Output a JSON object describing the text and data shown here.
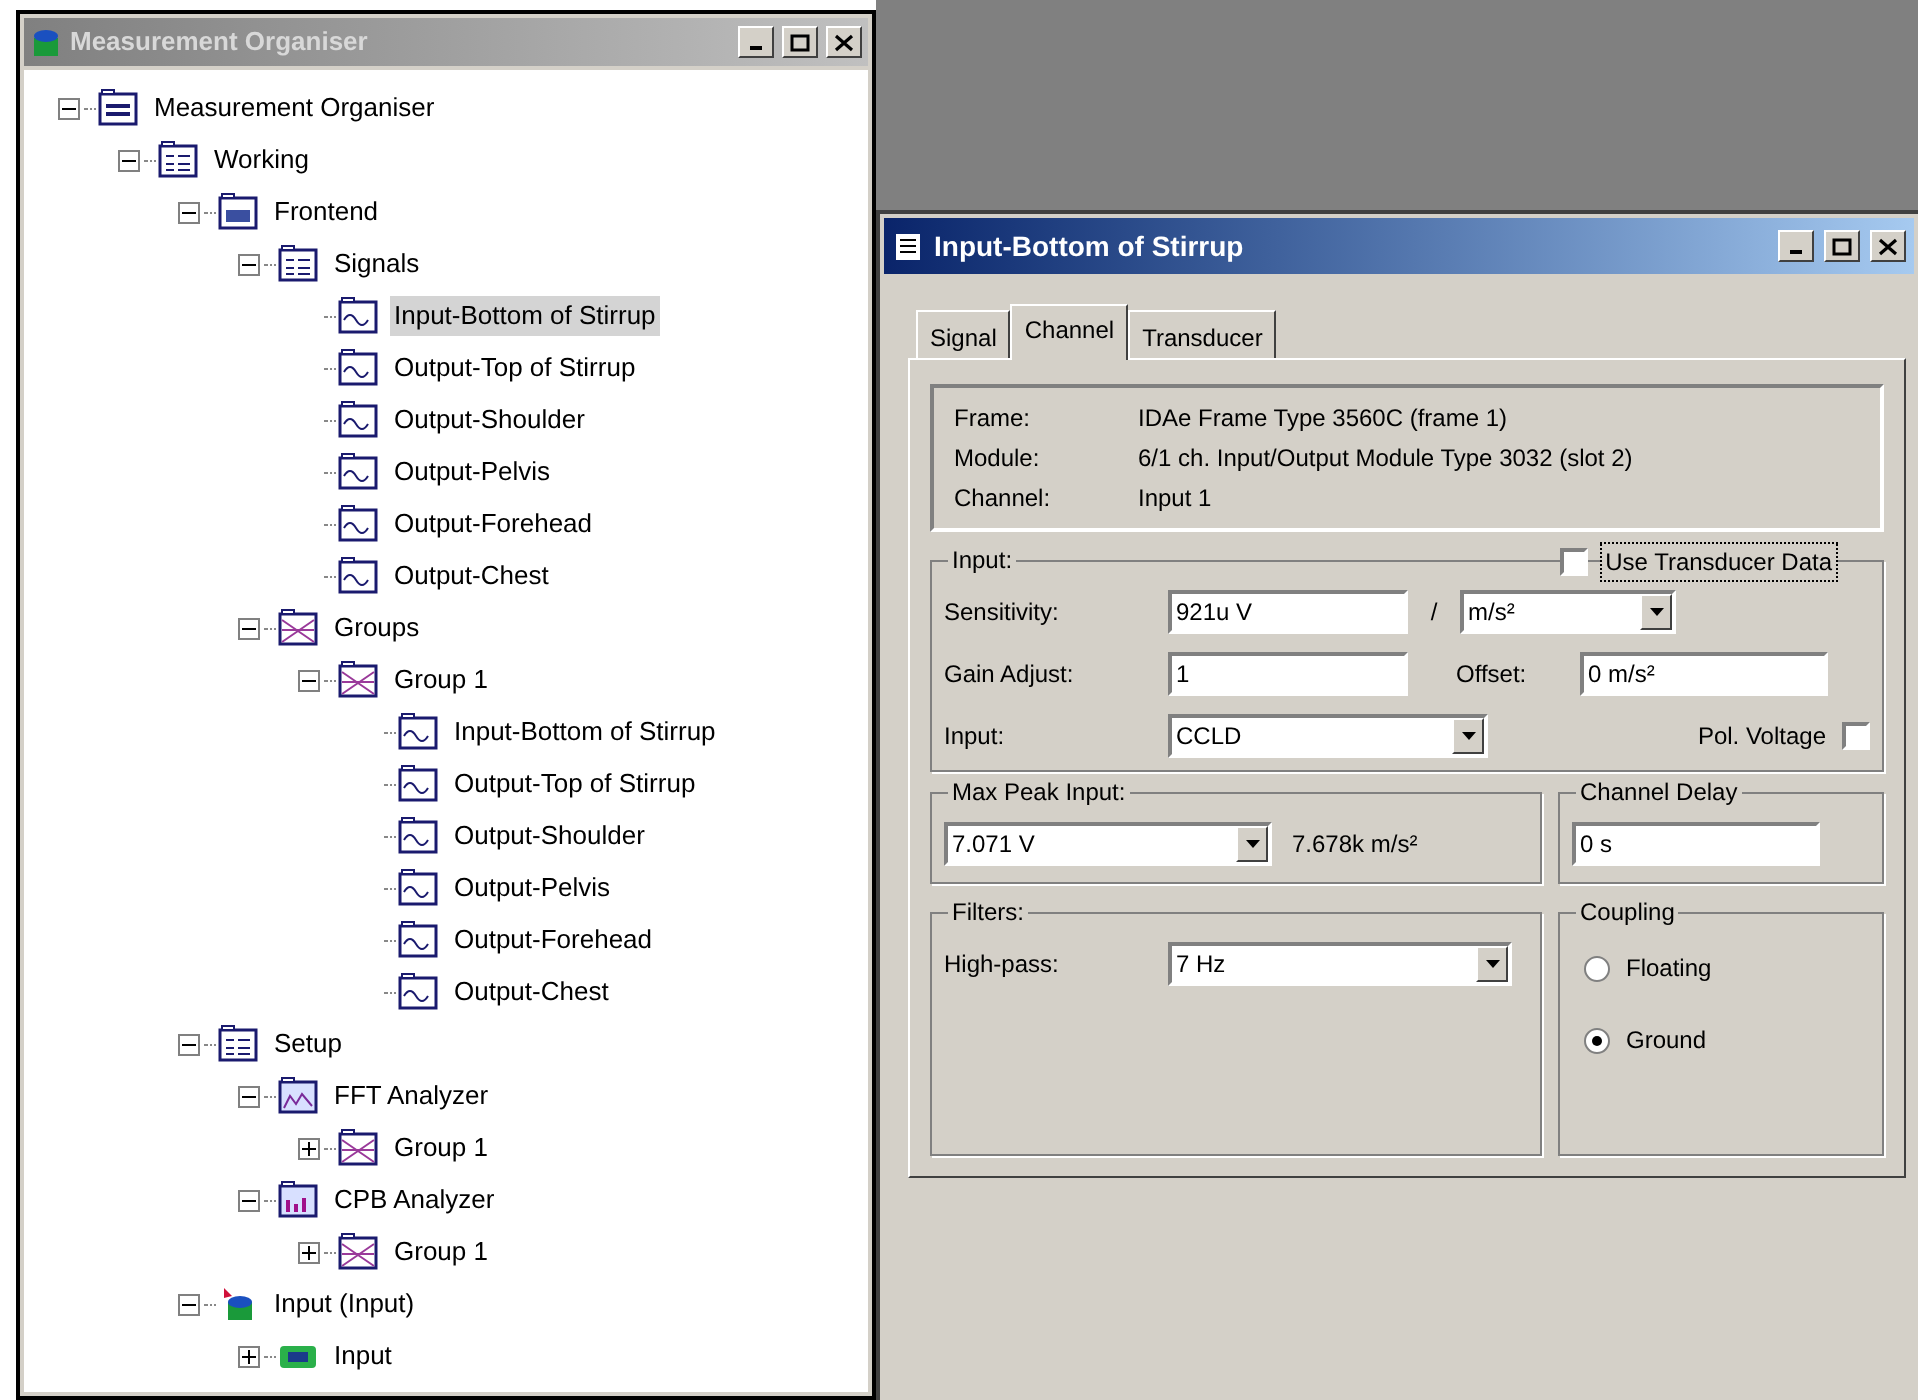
{
  "organiser": {
    "title": "Measurement Organiser",
    "tree": [
      {
        "label": "Measurement Organiser",
        "kind": "organiser",
        "expanded": true,
        "selected": false,
        "children": [
          {
            "label": "Working",
            "kind": "list",
            "expanded": true,
            "selected": false,
            "children": [
              {
                "label": "Frontend",
                "kind": "frontend",
                "expanded": true,
                "selected": false,
                "children": [
                  {
                    "label": "Signals",
                    "kind": "list",
                    "expanded": true,
                    "selected": false,
                    "children": [
                      {
                        "label": "Input-Bottom of Stirrup",
                        "kind": "signal",
                        "selected": true
                      },
                      {
                        "label": "Output-Top of Stirrup",
                        "kind": "signal",
                        "selected": false
                      },
                      {
                        "label": "Output-Shoulder",
                        "kind": "signal",
                        "selected": false
                      },
                      {
                        "label": "Output-Pelvis",
                        "kind": "signal",
                        "selected": false
                      },
                      {
                        "label": "Output-Forehead",
                        "kind": "signal",
                        "selected": false
                      },
                      {
                        "label": "Output-Chest",
                        "kind": "signal",
                        "selected": false
                      }
                    ]
                  },
                  {
                    "label": "Groups",
                    "kind": "group",
                    "expanded": true,
                    "selected": false,
                    "children": [
                      {
                        "label": "Group 1",
                        "kind": "group",
                        "expanded": true,
                        "selected": false,
                        "children": [
                          {
                            "label": "Input-Bottom of Stirrup",
                            "kind": "signal",
                            "selected": false
                          },
                          {
                            "label": "Output-Top of Stirrup",
                            "kind": "signal",
                            "selected": false
                          },
                          {
                            "label": "Output-Shoulder",
                            "kind": "signal",
                            "selected": false
                          },
                          {
                            "label": "Output-Pelvis",
                            "kind": "signal",
                            "selected": false
                          },
                          {
                            "label": "Output-Forehead",
                            "kind": "signal",
                            "selected": false
                          },
                          {
                            "label": "Output-Chest",
                            "kind": "signal",
                            "selected": false
                          }
                        ]
                      }
                    ]
                  }
                ]
              },
              {
                "label": "Setup",
                "kind": "list",
                "expanded": true,
                "selected": false,
                "children": [
                  {
                    "label": "FFT Analyzer",
                    "kind": "fft",
                    "expanded": true,
                    "selected": false,
                    "children": [
                      {
                        "label": "Group 1",
                        "kind": "group",
                        "expanded": false,
                        "selected": false
                      }
                    ]
                  },
                  {
                    "label": "CPB Analyzer",
                    "kind": "cpb",
                    "expanded": true,
                    "selected": false,
                    "children": [
                      {
                        "label": "Group 1",
                        "kind": "group",
                        "expanded": false,
                        "selected": false
                      }
                    ]
                  }
                ]
              },
              {
                "label": "Input (Input)",
                "kind": "device",
                "expanded": true,
                "selected": false,
                "children": [
                  {
                    "label": "Input",
                    "kind": "module",
                    "expanded": false,
                    "selected": false
                  }
                ]
              }
            ]
          }
        ]
      }
    ]
  },
  "dialog": {
    "title": "Input-Bottom of Stirrup",
    "tabs": [
      {
        "label": "Signal",
        "selected": false
      },
      {
        "label": "Channel",
        "selected": true
      },
      {
        "label": "Transducer",
        "selected": false
      }
    ],
    "info": [
      {
        "label": "Frame:",
        "value": "IDAe Frame Type 3560C (frame 1)"
      },
      {
        "label": "Module:",
        "value": "6/1 ch. Input/Output Module Type 3032 (slot 2)"
      },
      {
        "label": "Channel:",
        "value": "Input 1"
      }
    ],
    "input_group": {
      "title": "Input:",
      "use_transducer": {
        "label": "Use Transducer Data",
        "checked": false
      },
      "sensitivity": {
        "label": "Sensitivity:",
        "value": "921u V",
        "separator": "/",
        "unit": "m/s²"
      },
      "gain": {
        "label": "Gain Adjust:",
        "value": "1"
      },
      "offset": {
        "label": "Offset:",
        "value": "0 m/s²"
      },
      "input": {
        "label": "Input:",
        "value": "CCLD"
      },
      "pol_voltage": {
        "label": "Pol. Voltage",
        "checked": false
      }
    },
    "max_peak": {
      "title": "Max Peak Input:",
      "value": "7.071 V",
      "reading": "7.678k m/s²"
    },
    "channel_delay": {
      "title": "Channel Delay",
      "value": "0 s"
    },
    "filters": {
      "title": "Filters:",
      "label": "High-pass:",
      "value": "7 Hz"
    },
    "coupling": {
      "title": "Coupling",
      "options": [
        {
          "label": "Floating",
          "selected": false
        },
        {
          "label": "Ground",
          "selected": true
        }
      ]
    }
  }
}
